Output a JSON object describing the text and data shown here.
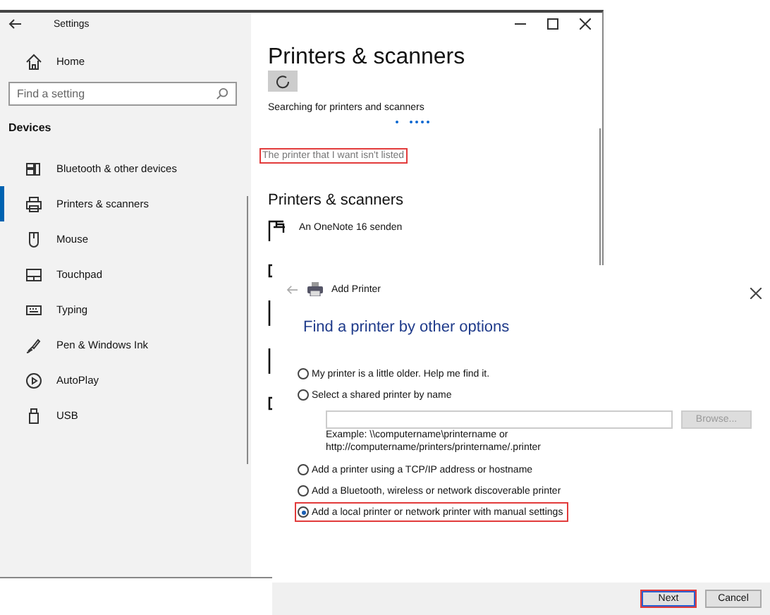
{
  "settings": {
    "title": "Settings",
    "home": "Home",
    "search": {
      "placeholder": "Find a setting"
    },
    "section": "Devices",
    "nav": [
      {
        "label": "Bluetooth & other devices",
        "selected": false
      },
      {
        "label": "Printers & scanners",
        "selected": true
      },
      {
        "label": "Mouse",
        "selected": false
      },
      {
        "label": "Touchpad",
        "selected": false
      },
      {
        "label": "Typing",
        "selected": false
      },
      {
        "label": "Pen & Windows Ink",
        "selected": false
      },
      {
        "label": "AutoPlay",
        "selected": false
      },
      {
        "label": "USB",
        "selected": false
      }
    ],
    "page_title": "Printers & scanners",
    "status": "Searching for printers and scanners",
    "link": {
      "text": "The printer that I want isn't listed",
      "highlighted": true
    },
    "list_heading": "Printers & scanners",
    "printers": [
      {
        "name": "An OneNote 16 senden"
      }
    ]
  },
  "dialog": {
    "title": "Add Printer",
    "heading": "Find a printer by other options",
    "options": [
      {
        "label": "My printer is a little older. Help me find it.",
        "selected": false,
        "highlighted": false
      },
      {
        "label": "Select a shared printer by name",
        "selected": false,
        "highlighted": false,
        "field": {
          "browse": "Browse...",
          "example": [
            "Example: \\\\computername\\printername or",
            "http://computername/printers/printername/.printer"
          ]
        }
      },
      {
        "label": "Add a printer using a TCP/IP address or hostname",
        "selected": false,
        "highlighted": false
      },
      {
        "label": "Add a Bluetooth, wireless or network discoverable printer",
        "selected": false,
        "highlighted": false
      },
      {
        "label": "Add a local printer or network printer with manual settings",
        "selected": true,
        "highlighted": true
      }
    ],
    "buttons": [
      {
        "label": "Next",
        "highlighted": true
      },
      {
        "label": "Cancel",
        "highlighted": false
      }
    ]
  }
}
